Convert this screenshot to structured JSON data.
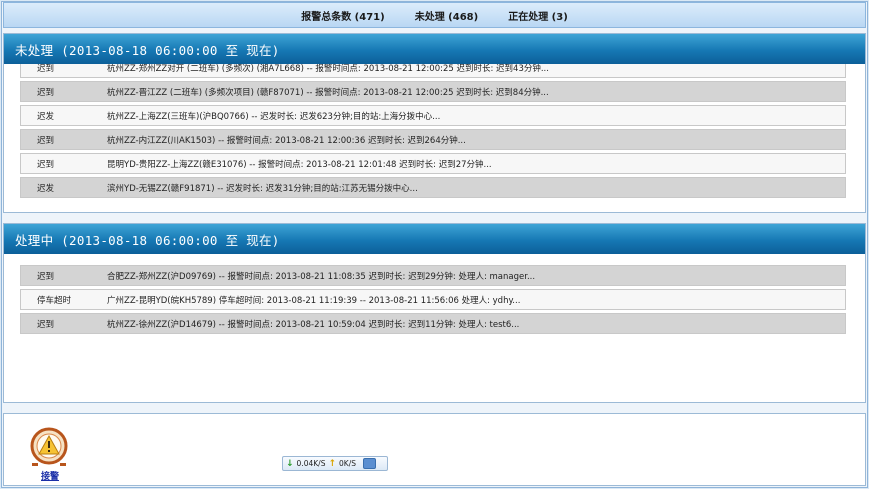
{
  "topbar": {
    "total": "报警总条数 (471)",
    "unprocessed": "未处理 (468)",
    "processing": "正在处理 (3)"
  },
  "unprocessed_panel": {
    "title": "未处理 (2013-08-18 06:00:00 至 现在)",
    "rows": [
      {
        "type": "迟到",
        "text": "杭州ZZ-郑州ZZ对开 (二班车) (多频次) (湘A7L668) -- 报警时间点: 2013-08-21 12:00:25 迟到时长: 迟到43分钟..."
      },
      {
        "type": "迟到",
        "text": "杭州ZZ-晋江ZZ (二班车) (多频次项目) (赣F87071) -- 报警时间点: 2013-08-21 12:00:25 迟到时长: 迟到84分钟..."
      },
      {
        "type": "迟发",
        "text": "杭州ZZ-上海ZZ(三班车)(沪BQ0766) -- 迟发时长: 迟发623分钟;目的站:上海分拨中心..."
      },
      {
        "type": "迟到",
        "text": "杭州ZZ-内江ZZ(川AK1503) -- 报警时间点: 2013-08-21 12:00:36 迟到时长: 迟到264分钟..."
      },
      {
        "type": "迟到",
        "text": "昆明YD-贵阳ZZ-上海ZZ(赣E31076) -- 报警时间点: 2013-08-21 12:01:48 迟到时长: 迟到27分钟..."
      },
      {
        "type": "迟发",
        "text": "滨州YD-无锡ZZ(赣F91871) -- 迟发时长: 迟发31分钟;目的站:江苏无锡分拨中心..."
      }
    ]
  },
  "processing_panel": {
    "title": "处理中 (2013-08-18 06:00:00 至 现在)",
    "rows": [
      {
        "type": "迟到",
        "text": "合肥ZZ-郑州ZZ(沪D09769) -- 报警时间点: 2013-08-21 11:08:35 迟到时长: 迟到29分钟: 处理人: manager..."
      },
      {
        "type": "停车超时",
        "text": "广州ZZ-昆明YD(皖KH5789) 停车超时间: 2013-08-21 11:19:39 -- 2013-08-21 11:56:06 处理人: ydhy..."
      },
      {
        "type": "迟到",
        "text": "杭州ZZ-徐州ZZ(沪D14679) -- 报警时间点: 2013-08-21 10:59:04 迟到时长: 迟到11分钟: 处理人: test6..."
      }
    ]
  },
  "status_bar": {
    "alarm_label": "接警",
    "download": "0.04K/S",
    "upload": "0K/S"
  }
}
